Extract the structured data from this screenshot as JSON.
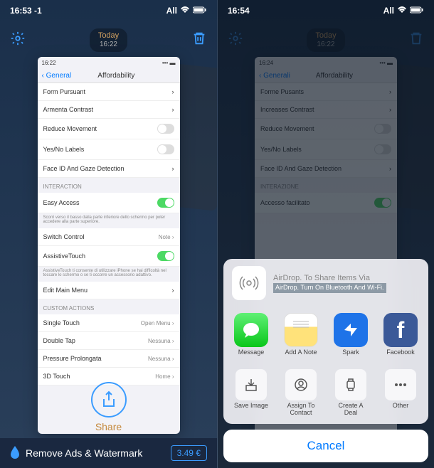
{
  "left": {
    "status": {
      "time": "16:53 -1",
      "carrier": "All"
    },
    "toolbar": {
      "today_label": "Today",
      "today_time": "16:22"
    },
    "screenshot": {
      "status_time": "16:22",
      "back": "General",
      "title": "Affordability",
      "rows": {
        "form_pursuant": "Form Pursuant",
        "armenta_contrast": "Armenta Contrast",
        "reduce_movement": "Reduce Movement",
        "yesno": "Yes/No Labels",
        "faceid": "Face ID And Gaze Detection"
      },
      "section_interaction": "Interaction",
      "easy_access": "Easy Access",
      "easy_note": "Scorri verso il basso dalla parte inferiore dello schermo per poter accedere alla parte superiore.",
      "switch_control": "Switch Control",
      "switch_val": "Note",
      "assistive": "AssistiveTouch",
      "assistive_note": "AssistiveTouch ti consente di utilizzare iPhone se hai difficoltà nel toccare lo schermo o se ti occorre un accessorio adattivo.",
      "edit_menu": "Edit Main Menu",
      "section_custom": "CUSTOM ACTIONS",
      "single_touch": "Single Touch",
      "single_val": "Open Menu",
      "double_tap": "Double Tap",
      "double_val": "Nessuna",
      "pressure": "Pressure Prolongata",
      "pressure_val": "Nessuna",
      "threed": "3D Touch",
      "threed_val": "Home"
    },
    "share_label": "Share",
    "bottom": {
      "remove": "Remove Ads & Watermark",
      "price": "3.49 €"
    }
  },
  "right": {
    "status": {
      "time": "16:54",
      "carrier": "All"
    },
    "toolbar": {
      "today_label": "Today",
      "today_time": "16:22"
    },
    "screenshot": {
      "status_time": "16:24",
      "back": "Generali",
      "title": "Affordability",
      "forme": "Forme Pusants",
      "increases": "Increases Contrast",
      "reduce": "Reduce Movement",
      "yesno": "Yes/No Labels",
      "faceid": "Face ID And Gaze Detection",
      "section_inter": "INTERAZIONE",
      "accesso": "Accesso facilitato"
    },
    "sheet": {
      "airdrop_title": "AirDrop. To Share Items Via",
      "airdrop_sub": "AirDrop. Turn On Bluetooth And Wi-Fi.",
      "apps": {
        "message": "Message",
        "notes": "Add A Note",
        "spark": "Spark",
        "facebook": "Facebook"
      },
      "actions": {
        "save": "Save Image",
        "assign": "Assign To Contact",
        "create": "Create A Deal",
        "other": "Other"
      },
      "cancel": "Cancel"
    }
  }
}
